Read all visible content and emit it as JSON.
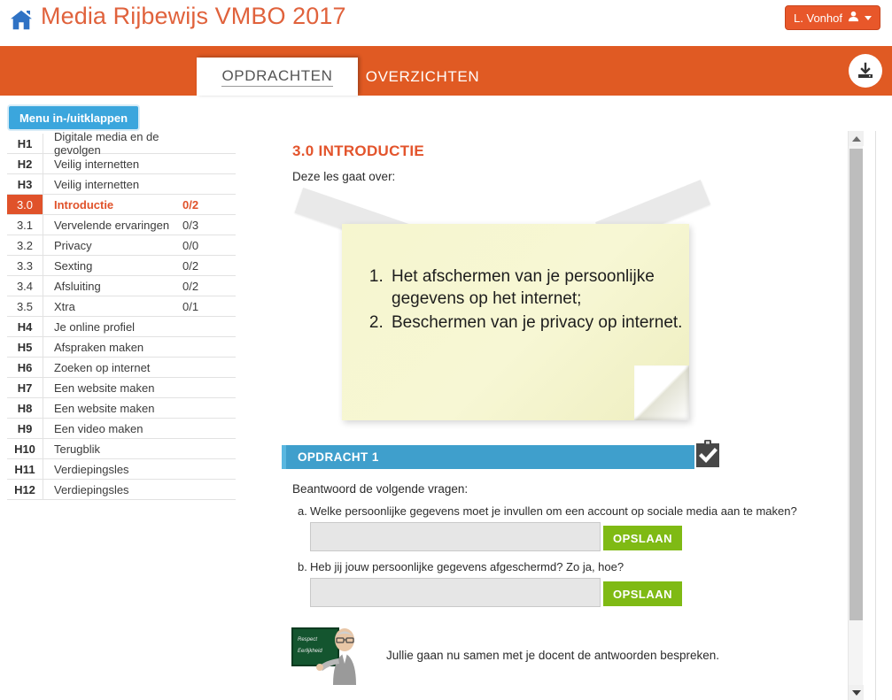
{
  "header": {
    "home_icon": "home-icon",
    "title": "Media Rijbewijs VMBO 2017",
    "user_button": {
      "label": "L. Vonhof",
      "icon": "user-icon",
      "caret": "chevron-down-icon"
    }
  },
  "nav": {
    "tabs": [
      {
        "label": "OPDRACHTEN",
        "active": true
      },
      {
        "label": "OVERZICHTEN",
        "active": false
      }
    ],
    "download_icon": "download-icon"
  },
  "sidebar": {
    "toggle_label": "Menu in-/uitklappen",
    "items": [
      {
        "num": "H1",
        "label": "Digitale media en de gevolgen",
        "score": "",
        "active": false,
        "sub": false
      },
      {
        "num": "H2",
        "label": "Veilig internetten",
        "score": "",
        "active": false,
        "sub": false
      },
      {
        "num": "H3",
        "label": "Veilig internetten",
        "score": "",
        "active": false,
        "sub": false
      },
      {
        "num": "3.0",
        "label": "Introductie",
        "score": "0/2",
        "active": true,
        "sub": true
      },
      {
        "num": "3.1",
        "label": "Vervelende ervaringen",
        "score": "0/3",
        "active": false,
        "sub": true
      },
      {
        "num": "3.2",
        "label": "Privacy",
        "score": "0/0",
        "active": false,
        "sub": true
      },
      {
        "num": "3.3",
        "label": "Sexting",
        "score": "0/2",
        "active": false,
        "sub": true
      },
      {
        "num": "3.4",
        "label": "Afsluiting",
        "score": "0/2",
        "active": false,
        "sub": true
      },
      {
        "num": "3.5",
        "label": "Xtra",
        "score": "0/1",
        "active": false,
        "sub": true
      },
      {
        "num": "H4",
        "label": "Je online profiel",
        "score": "",
        "active": false,
        "sub": false
      },
      {
        "num": "H5",
        "label": "Afspraken maken",
        "score": "",
        "active": false,
        "sub": false
      },
      {
        "num": "H6",
        "label": "Zoeken op internet",
        "score": "",
        "active": false,
        "sub": false
      },
      {
        "num": "H7",
        "label": "Een website maken",
        "score": "",
        "active": false,
        "sub": false
      },
      {
        "num": "H8",
        "label": "Een website maken",
        "score": "",
        "active": false,
        "sub": false
      },
      {
        "num": "H9",
        "label": "Een video maken",
        "score": "",
        "active": false,
        "sub": false
      },
      {
        "num": "H10",
        "label": "Terugblik",
        "score": "",
        "active": false,
        "sub": false
      },
      {
        "num": "H11",
        "label": "Verdiepingsles",
        "score": "",
        "active": false,
        "sub": false
      },
      {
        "num": "H12",
        "label": "Verdiepingsles",
        "score": "",
        "active": false,
        "sub": false
      }
    ]
  },
  "main": {
    "lesson_title": "3.0 INTRODUCTIE",
    "lesson_intro": "Deze les gaat over:",
    "sticky_note": {
      "items": [
        "Het afschermen van je persoonlijke gegevens op het internet;",
        "Beschermen van je privacy op internet."
      ]
    },
    "assignment": {
      "bar_label": "OPDRACHT 1",
      "icon": "clipboard-check-icon",
      "intro": "Beantwoord de volgende vragen:",
      "questions": [
        {
          "letter": "a.",
          "text": "Welke persoonlijke gegevens moet je invullen om een account op sociale media aan te maken?",
          "answer_value": "",
          "answer_placeholder": "",
          "save_label": "OPSLAAN"
        },
        {
          "letter": "b.",
          "text": "Heb jij jouw persoonlijke gegevens afgeschermd? Zo ja, hoe?",
          "answer_value": "",
          "answer_placeholder": "",
          "save_label": "OPSLAAN"
        }
      ]
    },
    "footer": {
      "image": "teacher-at-chalkboard-image",
      "text": "Jullie gaan nu samen met je docent de antwoorden bespreken."
    }
  },
  "scrollbar": {
    "up_icon": "scroll-up-arrow-icon",
    "down_icon": "scroll-down-arrow-icon",
    "thumb": "scroll-thumb"
  },
  "colors": {
    "brand_orange": "#e05a23",
    "title_orange": "#e0623c",
    "accent_blue": "#3ba6dd",
    "assignment_blue": "#3f9fcc",
    "save_green": "#7fba14",
    "active_red": "#e0522a",
    "note_yellow": "#f6f6cf"
  }
}
